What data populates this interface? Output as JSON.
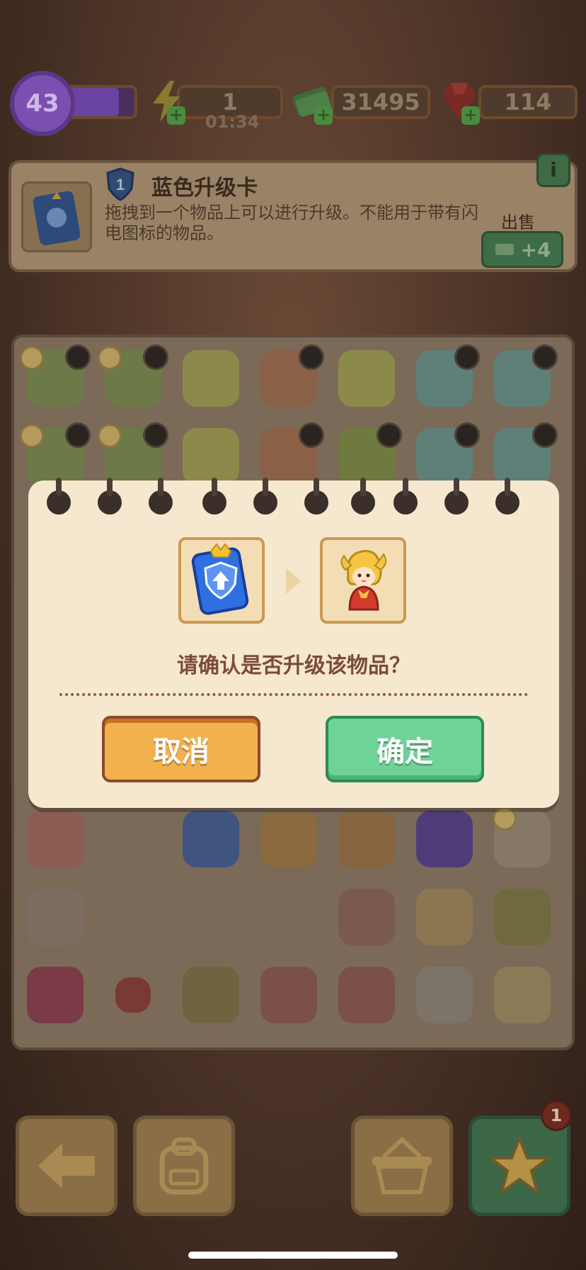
{
  "hud": {
    "level": "43",
    "energy": "1",
    "energy_timer": "01:34",
    "cash": "31495",
    "gems": "114"
  },
  "info_panel": {
    "badge_number": "1",
    "title": "蓝色升级卡",
    "description": "拖拽到一个物品上可以进行升级。不能用于带有闪电图标的物品。",
    "sell_label": "出售",
    "sell_value": "+4",
    "info_icon": "i"
  },
  "dialog": {
    "question": "请确认是否升级该物品？",
    "cancel_label": "取消",
    "confirm_label": "确定",
    "left_item": "blue-upgrade-card-icon",
    "right_item": "character-doll-icon"
  },
  "bottom_bar": {
    "notification_count": "1",
    "buttons": [
      "back-arrow-icon",
      "backpack-icon",
      "basket-icon",
      "star-icon"
    ]
  },
  "colors": {
    "cancel": "#f2b14f",
    "confirm": "#6fd398",
    "dialog_bg": "#f6e7cf",
    "question_text": "#7a4c3a"
  }
}
